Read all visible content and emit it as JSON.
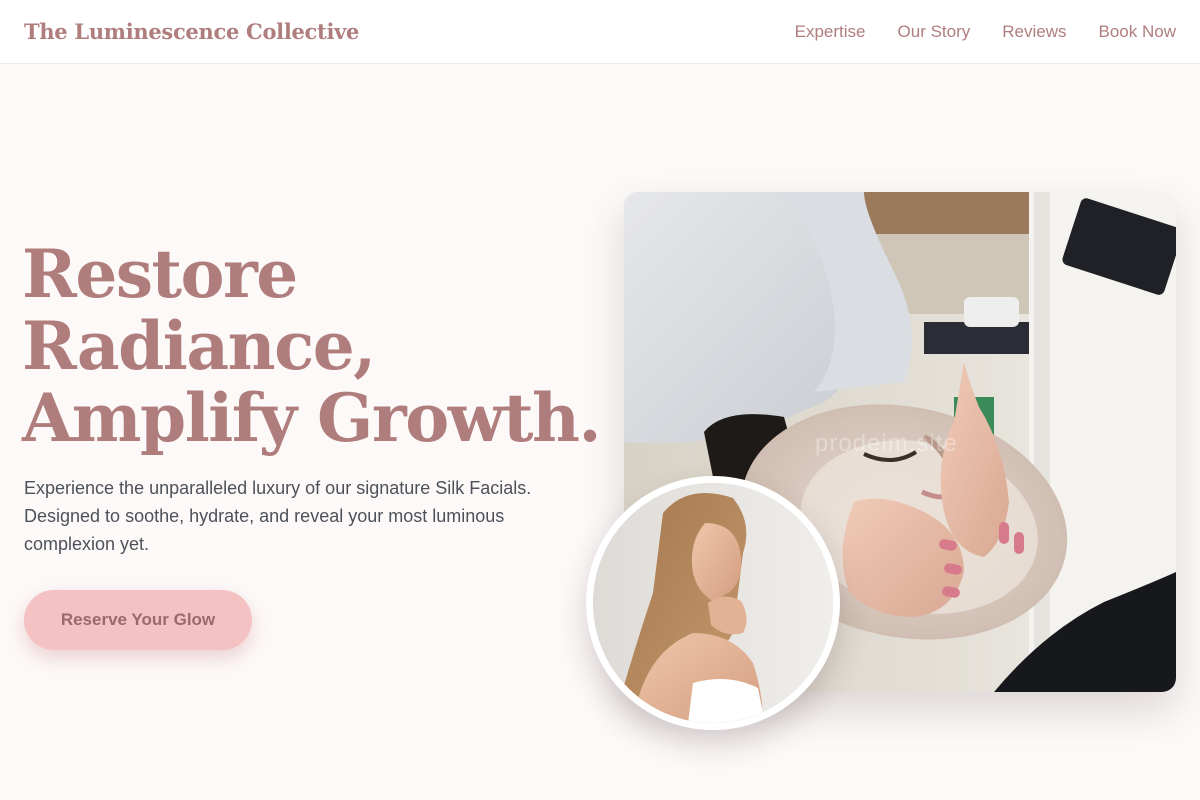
{
  "header": {
    "brand": "The Luminescence Collective",
    "nav": [
      {
        "label": "Expertise"
      },
      {
        "label": "Our Story"
      },
      {
        "label": "Reviews"
      },
      {
        "label": "Book Now"
      }
    ]
  },
  "hero": {
    "title_lines": [
      "Restore",
      "Radiance,",
      "Amplify Growth."
    ],
    "description": "Experience the unparalleled luxury of our signature Silk Facials. Designed to soothe, hydrate, and reveal your most luminous complexion yet.",
    "cta_label": "Reserve Your Glow"
  },
  "images": {
    "main_watermark": "prodeim.site"
  },
  "colors": {
    "accent": "#b07d7d",
    "button_bg": "#f4c2c2",
    "page_bg": "#fdf9f9"
  }
}
